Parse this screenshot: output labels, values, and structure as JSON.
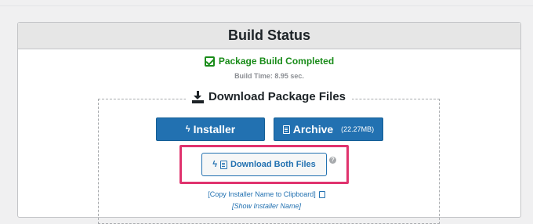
{
  "panel": {
    "title": "Build Status"
  },
  "status": {
    "message": "Package Build Completed",
    "build_time": "Build Time: 8.95 sec."
  },
  "download": {
    "legend": "Download Package Files",
    "installer_label": "Installer",
    "archive_label": "Archive",
    "archive_size": "(22.27MB)",
    "both_label": "Download Both Files",
    "help_glyph": "?",
    "copy_link": "[Copy Installer Name to Clipboard]",
    "show_link": "[Show Installer Name]"
  },
  "colors": {
    "primary": "#2271b1",
    "success": "#1a8c1a",
    "highlight": "#e0336e"
  },
  "icons": {
    "status": "checkbox-checked-icon",
    "legend": "download-icon",
    "installer": "bolt-icon",
    "archive": "file-archive-icon",
    "help": "question-circle-icon",
    "copy": "copy-icon"
  }
}
